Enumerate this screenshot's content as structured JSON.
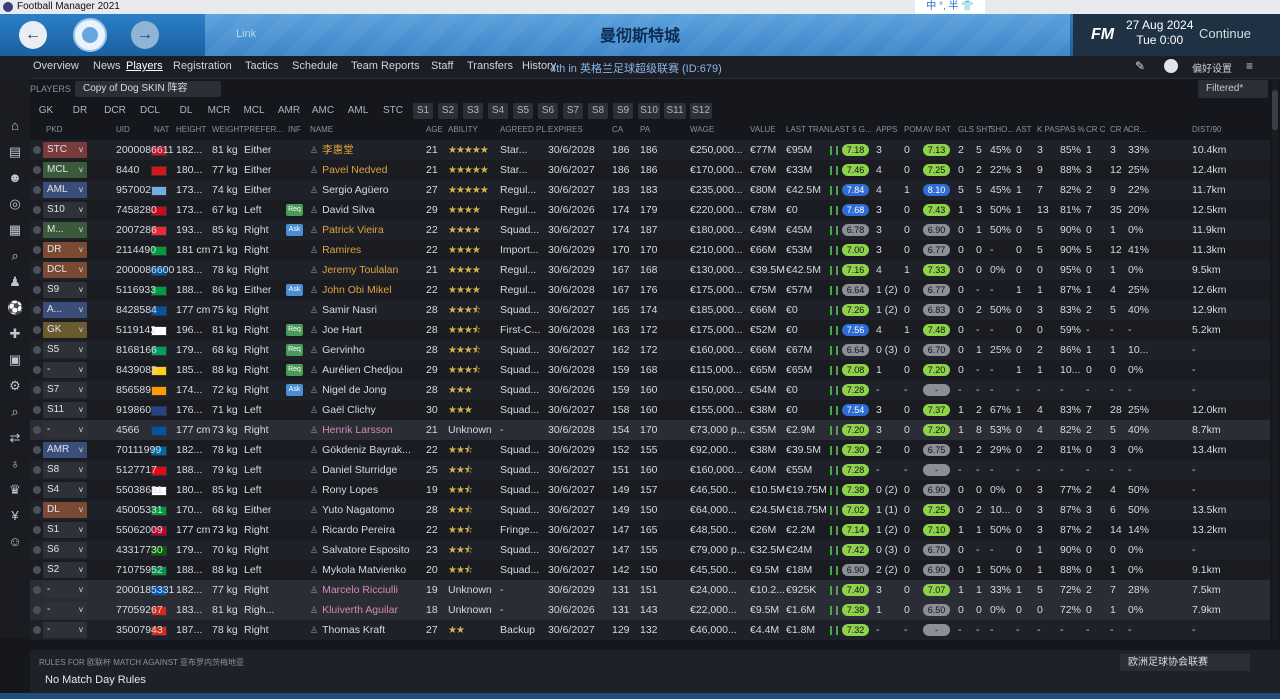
{
  "window": {
    "title": "Football Manager 2021"
  },
  "header": {
    "link": "Link",
    "club_name": "曼彻斯特城",
    "date": "27 Aug 2024",
    "time": "Tue 0:00",
    "continue_label": "Continue",
    "fm_logo": "FM",
    "ime_text": "中 °, 半 👕"
  },
  "menu": {
    "items": [
      "Overview",
      "News",
      "Players",
      "Registration",
      "Tactics",
      "Schedule",
      "Team Reports",
      "Staff",
      "Transfers",
      "History"
    ],
    "competition": "4th in 英格兰足球超级联赛 (ID:679)",
    "settings_label": "偏好设置"
  },
  "toolbar": {
    "players_label": "PLAYERS",
    "skin_label": "Copy of Dog SKIN 阵容",
    "filtered_label": "Filtered*"
  },
  "position_tabs": [
    "GK",
    "DR",
    "DCR",
    "DCL",
    "DL",
    "MCR",
    "MCL",
    "AMR",
    "AMC",
    "AML",
    "STC",
    "S1",
    "S2",
    "S3",
    "S4",
    "S5",
    "S6",
    "S7",
    "S8",
    "S9",
    "S10",
    "S11",
    "S12"
  ],
  "columns": [
    "PKD",
    "UID",
    "NAT",
    "HEIGHT",
    "WEIGHT",
    "PREFER...",
    "INF",
    "NAME",
    "AGE",
    "ABILITY",
    "AGREED PL...",
    "EXPIRES",
    "CA",
    "PA",
    "WAGE",
    "VALUE",
    "LAST TRAN...",
    "LAST 5 G...",
    "APPS",
    "POM",
    "AV RAT",
    "GLS",
    "SHT",
    "SHO...",
    "AST",
    "K PAS",
    "PAS %",
    "CR C",
    "CR A",
    "CR...",
    "DIST/90"
  ],
  "players": [
    {
      "pkd": "STC",
      "uid": "2000086611",
      "height": "182...",
      "weight": "81 kg",
      "pref": "Either",
      "inf": "",
      "name": "李惠堂",
      "age": "21",
      "stars": 5,
      "ability": "",
      "agreed": "Star...",
      "expires": "30/6/2028",
      "ca": "186",
      "pa": "186",
      "wage": "€250,000...",
      "value": "€77M",
      "last": "€95M",
      "l5": "7.18",
      "apps": "3",
      "pom": "0",
      "av": "7.13",
      "gls": "2",
      "sht": "5",
      "sho": "45%",
      "ast": "0",
      "kpas": "3",
      "pas": "85%",
      "crc": "1",
      "cra": "3",
      "cr": "33%",
      "dist": "10.4km"
    },
    {
      "pkd": "MCL",
      "uid": "8440",
      "height": "180...",
      "weight": "77 kg",
      "pref": "Either",
      "inf": "",
      "name": "Pavel Nedved",
      "age": "21",
      "stars": 5,
      "ability": "",
      "agreed": "Star...",
      "expires": "30/6/2027",
      "ca": "186",
      "pa": "186",
      "wage": "€170,000...",
      "value": "€76M",
      "last": "€33M",
      "l5": "7.46",
      "apps": "4",
      "pom": "0",
      "av": "7.25",
      "gls": "0",
      "sht": "2",
      "sho": "22%",
      "ast": "3",
      "kpas": "9",
      "pas": "88%",
      "crc": "3",
      "cra": "12",
      "cr": "25%",
      "dist": "12.4km"
    },
    {
      "pkd": "AML",
      "uid": "957002",
      "height": "173...",
      "weight": "74 kg",
      "pref": "Either",
      "inf": "",
      "name": "Sergio Agüero",
      "age": "27",
      "stars": 5,
      "ability": "",
      "agreed": "Regul...",
      "expires": "30/6/2027",
      "ca": "183",
      "pa": "183",
      "wage": "€235,000...",
      "value": "€80M",
      "last": "€42.5M",
      "l5": "7.84",
      "apps": "4",
      "pom": "1",
      "av": "8.10",
      "gls": "5",
      "sht": "5",
      "sho": "45%",
      "ast": "1",
      "kpas": "7",
      "pas": "82%",
      "crc": "2",
      "cra": "9",
      "cr": "22%",
      "dist": "11.7km"
    },
    {
      "pkd": "S10",
      "uid": "7458280",
      "height": "173...",
      "weight": "67 kg",
      "pref": "Left",
      "inf": "Req",
      "name": "David Silva",
      "age": "29",
      "stars": 4,
      "ability": "",
      "agreed": "Regul...",
      "expires": "30/6/2026",
      "ca": "174",
      "pa": "179",
      "wage": "€220,000...",
      "value": "€78M",
      "last": "€0",
      "l5": "7.68",
      "apps": "3",
      "pom": "0",
      "av": "7.43",
      "gls": "1",
      "sht": "3",
      "sho": "50%",
      "ast": "1",
      "kpas": "13",
      "pas": "81%",
      "crc": "7",
      "cra": "35",
      "cr": "20%",
      "dist": "12.5km"
    },
    {
      "pkd": "M...",
      "uid": "2007286",
      "height": "193...",
      "weight": "85 kg",
      "pref": "Right",
      "inf": "Ask",
      "name": "Patrick Vieira",
      "age": "22",
      "stars": 4,
      "ability": "",
      "agreed": "Squad...",
      "expires": "30/6/2027",
      "ca": "174",
      "pa": "187",
      "wage": "€180,000...",
      "value": "€49M",
      "last": "€45M",
      "l5": "6.78",
      "apps": "3",
      "pom": "0",
      "av": "6.90",
      "gls": "0",
      "sht": "1",
      "sho": "50%",
      "ast": "0",
      "kpas": "5",
      "pas": "90%",
      "crc": "0",
      "cra": "1",
      "cr": "0%",
      "dist": "11.9km"
    },
    {
      "pkd": "DR",
      "uid": "2114490",
      "height": "181 cm",
      "weight": "71 kg",
      "pref": "Right",
      "inf": "",
      "name": "Ramires",
      "age": "22",
      "stars": 4,
      "ability": "",
      "agreed": "Import...",
      "expires": "30/6/2029",
      "ca": "170",
      "pa": "170",
      "wage": "€210,000...",
      "value": "€66M",
      "last": "€53M",
      "l5": "7.00",
      "apps": "3",
      "pom": "0",
      "av": "6.77",
      "gls": "0",
      "sht": "0",
      "sho": "-",
      "ast": "0",
      "kpas": "5",
      "pas": "90%",
      "crc": "5",
      "cra": "12",
      "cr": "41%",
      "dist": "11.3km"
    },
    {
      "pkd": "DCL",
      "uid": "2000086600",
      "height": "183...",
      "weight": "78 kg",
      "pref": "Right",
      "inf": "",
      "name": "Jeremy Toulalan",
      "age": "21",
      "stars": 4,
      "ability": "",
      "agreed": "Regul...",
      "expires": "30/6/2029",
      "ca": "167",
      "pa": "168",
      "wage": "€130,000...",
      "value": "€39.5M",
      "last": "€42.5M",
      "l5": "7.16",
      "apps": "4",
      "pom": "1",
      "av": "7.33",
      "gls": "0",
      "sht": "0",
      "sho": "0%",
      "ast": "0",
      "kpas": "0",
      "pas": "95%",
      "crc": "0",
      "cra": "1",
      "cr": "0%",
      "dist": "9.5km"
    },
    {
      "pkd": "S9",
      "uid": "5116933",
      "height": "188...",
      "weight": "86 kg",
      "pref": "Either",
      "inf": "Ask",
      "name": "John Obi Mikel",
      "age": "22",
      "stars": 4,
      "ability": "",
      "agreed": "Regul...",
      "expires": "30/6/2028",
      "ca": "167",
      "pa": "176",
      "wage": "€175,000...",
      "value": "€75M",
      "last": "€57M",
      "l5": "6.64",
      "apps": "1 (2)",
      "pom": "0",
      "av": "6.77",
      "gls": "0",
      "sht": "-",
      "sho": "-",
      "ast": "1",
      "kpas": "1",
      "pas": "87%",
      "crc": "1",
      "cra": "4",
      "cr": "25%",
      "dist": "12.6km"
    },
    {
      "pkd": "A...",
      "uid": "8428584",
      "height": "177 cm",
      "weight": "75 kg",
      "pref": "Right",
      "inf": "",
      "name": "Samir Nasri",
      "age": "28",
      "stars": 3.5,
      "ability": "",
      "agreed": "Squad...",
      "expires": "30/6/2027",
      "ca": "165",
      "pa": "174",
      "wage": "€185,000...",
      "value": "€66M",
      "last": "€0",
      "l5": "7.26",
      "apps": "1 (2)",
      "pom": "0",
      "av": "6.83",
      "gls": "0",
      "sht": "2",
      "sho": "50%",
      "ast": "0",
      "kpas": "3",
      "pas": "83%",
      "crc": "2",
      "cra": "5",
      "cr": "40%",
      "dist": "12.9km"
    },
    {
      "pkd": "GK",
      "uid": "5119142",
      "height": "196...",
      "weight": "81 kg",
      "pref": "Right",
      "inf": "Req",
      "name": "Joe Hart",
      "age": "28",
      "stars": 3.5,
      "ability": "",
      "agreed": "First-C...",
      "expires": "30/6/2028",
      "ca": "163",
      "pa": "172",
      "wage": "€175,000...",
      "value": "€52M",
      "last": "€0",
      "l5": "7.56",
      "apps": "4",
      "pom": "1",
      "av": "7.48",
      "gls": "0",
      "sht": "-",
      "sho": "-",
      "ast": "0",
      "kpas": "0",
      "pas": "59%",
      "crc": "-",
      "cra": "-",
      "cr": "-",
      "dist": "5.2km"
    },
    {
      "pkd": "S5",
      "uid": "8168166",
      "height": "179...",
      "weight": "68 kg",
      "pref": "Right",
      "inf": "Req",
      "name": "Gervinho",
      "age": "28",
      "stars": 3.5,
      "ability": "",
      "agreed": "Squad...",
      "expires": "30/6/2027",
      "ca": "162",
      "pa": "172",
      "wage": "€160,000...",
      "value": "€66M",
      "last": "€67M",
      "l5": "6.64",
      "apps": "0 (3)",
      "pom": "0",
      "av": "6.70",
      "gls": "0",
      "sht": "1",
      "sho": "25%",
      "ast": "0",
      "kpas": "2",
      "pas": "86%",
      "crc": "1",
      "cra": "1",
      "cr": "10...",
      "dist": "-"
    },
    {
      "pkd": "-",
      "uid": "8439083",
      "height": "185...",
      "weight": "88 kg",
      "pref": "Right",
      "inf": "Req",
      "name": "Aurélien Chedjou",
      "age": "29",
      "stars": 3.5,
      "ability": "",
      "agreed": "Squad...",
      "expires": "30/6/2028",
      "ca": "159",
      "pa": "168",
      "wage": "€115,000...",
      "value": "€65M",
      "last": "€65M",
      "l5": "7.08",
      "apps": "1",
      "pom": "0",
      "av": "7.20",
      "gls": "0",
      "sht": "-",
      "sho": "-",
      "ast": "1",
      "kpas": "1",
      "pas": "10...",
      "crc": "0",
      "cra": "0",
      "cr": "0%",
      "dist": "-"
    },
    {
      "pkd": "S7",
      "uid": "856589",
      "height": "174...",
      "weight": "72 kg",
      "pref": "Right",
      "inf": "Ask",
      "name": "Nigel de Jong",
      "age": "28",
      "stars": 3,
      "ability": "",
      "agreed": "Squad...",
      "expires": "30/6/2026",
      "ca": "159",
      "pa": "160",
      "wage": "€150,000...",
      "value": "€54M",
      "last": "€0",
      "l5": "7.28",
      "apps": "-",
      "pom": "-",
      "av": "-",
      "gls": "-",
      "sht": "-",
      "sho": "-",
      "ast": "-",
      "kpas": "-",
      "pas": "-",
      "crc": "-",
      "cra": "-",
      "cr": "-",
      "dist": "-"
    },
    {
      "pkd": "S11",
      "uid": "919860",
      "height": "176...",
      "weight": "71 kg",
      "pref": "Left",
      "inf": "",
      "name": "Gaël Clichy",
      "age": "30",
      "stars": 3,
      "ability": "",
      "agreed": "Squad...",
      "expires": "30/6/2027",
      "ca": "158",
      "pa": "160",
      "wage": "€155,000...",
      "value": "€38M",
      "last": "€0",
      "l5": "7.54",
      "apps": "3",
      "pom": "0",
      "av": "7.37",
      "gls": "1",
      "sht": "2",
      "sho": "67%",
      "ast": "1",
      "kpas": "4",
      "pas": "83%",
      "crc": "7",
      "cra": "28",
      "cr": "25%",
      "dist": "12.0km"
    },
    {
      "pkd": "-",
      "uid": "4566",
      "height": "177 cm",
      "weight": "73 kg",
      "pref": "Right",
      "inf": "",
      "name": "Henrik Larsson",
      "age": "21",
      "stars": 0,
      "ability": "Unknown",
      "agreed": "-",
      "expires": "30/6/2028",
      "ca": "154",
      "pa": "170",
      "wage": "€73,000 p...",
      "value": "€35M",
      "last": "€2.9M",
      "l5": "7.20",
      "apps": "3",
      "pom": "0",
      "av": "7.20",
      "gls": "1",
      "sht": "8",
      "sho": "53%",
      "ast": "0",
      "kpas": "4",
      "pas": "82%",
      "crc": "2",
      "cra": "5",
      "cr": "40%",
      "dist": "8.7km",
      "hl": true
    },
    {
      "pkd": "AMR",
      "uid": "70111999",
      "height": "182...",
      "weight": "78 kg",
      "pref": "Left",
      "inf": "",
      "name": "Gökdeniz Bayrak...",
      "age": "22",
      "stars": 2.5,
      "ability": "",
      "agreed": "Squad...",
      "expires": "30/6/2029",
      "ca": "152",
      "pa": "155",
      "wage": "€92,000...",
      "value": "€38M",
      "last": "€39.5M",
      "l5": "7.30",
      "apps": "2",
      "pom": "0",
      "av": "6.75",
      "gls": "1",
      "sht": "2",
      "sho": "29%",
      "ast": "0",
      "kpas": "2",
      "pas": "81%",
      "crc": "0",
      "cra": "3",
      "cr": "0%",
      "dist": "13.4km"
    },
    {
      "pkd": "S8",
      "uid": "5127717",
      "height": "188...",
      "weight": "79 kg",
      "pref": "Left",
      "inf": "",
      "name": "Daniel Sturridge",
      "age": "25",
      "stars": 2.5,
      "ability": "",
      "agreed": "Squad...",
      "expires": "30/6/2027",
      "ca": "151",
      "pa": "160",
      "wage": "€160,000...",
      "value": "€40M",
      "last": "€55M",
      "l5": "7.28",
      "apps": "-",
      "pom": "-",
      "av": "-",
      "gls": "-",
      "sht": "-",
      "sho": "-",
      "ast": "-",
      "kpas": "-",
      "pas": "-",
      "crc": "-",
      "cra": "-",
      "cr": "-",
      "dist": "-"
    },
    {
      "pkd": "S4",
      "uid": "55038681",
      "height": "180...",
      "weight": "85 kg",
      "pref": "Left",
      "inf": "",
      "name": "Rony Lopes",
      "age": "19",
      "stars": 2.5,
      "ability": "",
      "agreed": "Squad...",
      "expires": "30/6/2027",
      "ca": "149",
      "pa": "157",
      "wage": "€46,500...",
      "value": "€10.5M",
      "last": "€19.75M",
      "l5": "7.38",
      "apps": "0 (2)",
      "pom": "0",
      "av": "6.90",
      "gls": "0",
      "sht": "0",
      "sho": "0%",
      "ast": "0",
      "kpas": "3",
      "pas": "77%",
      "crc": "2",
      "cra": "4",
      "cr": "50%",
      "dist": "-"
    },
    {
      "pkd": "DL",
      "uid": "45005331",
      "height": "170...",
      "weight": "68 kg",
      "pref": "Either",
      "inf": "",
      "name": "Yuto Nagatomo",
      "age": "28",
      "stars": 2.5,
      "ability": "",
      "agreed": "Squad...",
      "expires": "30/6/2027",
      "ca": "149",
      "pa": "150",
      "wage": "€64,000...",
      "value": "€24.5M",
      "last": "€18.75M",
      "l5": "7.02",
      "apps": "1 (1)",
      "pom": "0",
      "av": "7.25",
      "gls": "0",
      "sht": "2",
      "sho": "10...",
      "ast": "0",
      "kpas": "3",
      "pas": "87%",
      "crc": "3",
      "cra": "6",
      "cr": "50%",
      "dist": "13.5km"
    },
    {
      "pkd": "S1",
      "uid": "55062009",
      "height": "177 cm",
      "weight": "73 kg",
      "pref": "Right",
      "inf": "",
      "name": "Ricardo Pereira",
      "age": "22",
      "stars": 2.5,
      "ability": "",
      "agreed": "Fringe...",
      "expires": "30/6/2027",
      "ca": "147",
      "pa": "165",
      "wage": "€48,500...",
      "value": "€26M",
      "last": "€2.2M",
      "l5": "7.14",
      "apps": "1 (2)",
      "pom": "0",
      "av": "7.10",
      "gls": "1",
      "sht": "1",
      "sho": "50%",
      "ast": "0",
      "kpas": "3",
      "pas": "87%",
      "crc": "2",
      "cra": "14",
      "cr": "14%",
      "dist": "13.2km"
    },
    {
      "pkd": "S6",
      "uid": "43317730",
      "height": "179...",
      "weight": "70 kg",
      "pref": "Right",
      "inf": "",
      "name": "Salvatore Esposito",
      "age": "23",
      "stars": 2.5,
      "ability": "",
      "agreed": "Squad...",
      "expires": "30/6/2027",
      "ca": "147",
      "pa": "155",
      "wage": "€79,000 p...",
      "value": "€32.5M",
      "last": "€24M",
      "l5": "7.42",
      "apps": "0 (3)",
      "pom": "0",
      "av": "6.70",
      "gls": "0",
      "sht": "-",
      "sho": "-",
      "ast": "0",
      "kpas": "1",
      "pas": "90%",
      "crc": "0",
      "cra": "0",
      "cr": "0%",
      "dist": "-"
    },
    {
      "pkd": "S2",
      "uid": "71075952",
      "height": "188...",
      "weight": "88 kg",
      "pref": "Left",
      "inf": "",
      "name": "Mykola Matvienko",
      "age": "20",
      "stars": 2.5,
      "ability": "",
      "agreed": "Squad...",
      "expires": "30/6/2027",
      "ca": "142",
      "pa": "150",
      "wage": "€45,500...",
      "value": "€9.5M",
      "last": "€18M",
      "l5": "6.90",
      "apps": "2 (2)",
      "pom": "0",
      "av": "6.90",
      "gls": "0",
      "sht": "1",
      "sho": "50%",
      "ast": "0",
      "kpas": "1",
      "pas": "88%",
      "crc": "0",
      "cra": "1",
      "cr": "0%",
      "dist": "9.1km"
    },
    {
      "pkd": "-",
      "uid": "2000185331",
      "height": "182...",
      "weight": "77 kg",
      "pref": "Right",
      "inf": "",
      "name": "Marcelo Ricciulli",
      "age": "19",
      "stars": 0,
      "ability": "Unknown",
      "agreed": "-",
      "expires": "30/6/2029",
      "ca": "131",
      "pa": "151",
      "wage": "€24,000...",
      "value": "€10.2...",
      "last": "€925K",
      "l5": "7.40",
      "apps": "3",
      "pom": "0",
      "av": "7.07",
      "gls": "1",
      "sht": "1",
      "sho": "33%",
      "ast": "1",
      "kpas": "5",
      "pas": "72%",
      "crc": "2",
      "cra": "7",
      "cr": "28%",
      "dist": "7.5km",
      "hl": true
    },
    {
      "pkd": "-",
      "uid": "77059267",
      "height": "183...",
      "weight": "81 kg",
      "pref": "Righ...",
      "inf": "",
      "name": "Kluiverth Aguilar",
      "age": "18",
      "stars": 0,
      "ability": "Unknown",
      "agreed": "-",
      "expires": "30/6/2026",
      "ca": "131",
      "pa": "143",
      "wage": "€22,000...",
      "value": "€9.5M",
      "last": "€1.6M",
      "l5": "7.38",
      "apps": "1",
      "pom": "0",
      "av": "6.50",
      "gls": "0",
      "sht": "0",
      "sho": "0%",
      "ast": "0",
      "kpas": "0",
      "pas": "72%",
      "crc": "0",
      "cra": "1",
      "cr": "0%",
      "dist": "7.9km",
      "hl": true
    },
    {
      "pkd": "-",
      "uid": "35007943",
      "height": "187...",
      "weight": "78 kg",
      "pref": "Right",
      "inf": "",
      "name": "Thomas Kraft",
      "age": "27",
      "stars": 2,
      "ability": "",
      "agreed": "Backup",
      "expires": "30/6/2027",
      "ca": "129",
      "pa": "132",
      "wage": "€46,000...",
      "value": "€4.4M",
      "last": "€1.8M",
      "l5": "7.32",
      "apps": "-",
      "pom": "-",
      "av": "-",
      "gls": "-",
      "sht": "-",
      "sho": "-",
      "ast": "-",
      "kpas": "-",
      "pas": "-",
      "crc": "-",
      "cra": "-",
      "cr": "-",
      "dist": "-"
    }
  ],
  "rules": {
    "title": "RULES FOR 欧联杯 MATCH AGAINST 亚布罗内茨梅地亚",
    "value": "No Match Day Rules",
    "dropdown": "欧洲足球协会联赛"
  },
  "colors": {
    "accent": "#2b7fc7",
    "rating_high": "#8ed14b",
    "rating_mid": "#e0e24b",
    "rating_blue": "#2f6cd4",
    "pkd_red": "#7a3b3b",
    "pkd_green": "#3b5a3b",
    "pkd_blue": "#3b4e7a",
    "inf_req": "#4a9a5a",
    "inf_ask": "#4a8fd1"
  },
  "icons": {
    "back": "left-arrow-icon",
    "forward": "right-arrow-icon",
    "home": "home-icon",
    "search": "search-icon"
  }
}
